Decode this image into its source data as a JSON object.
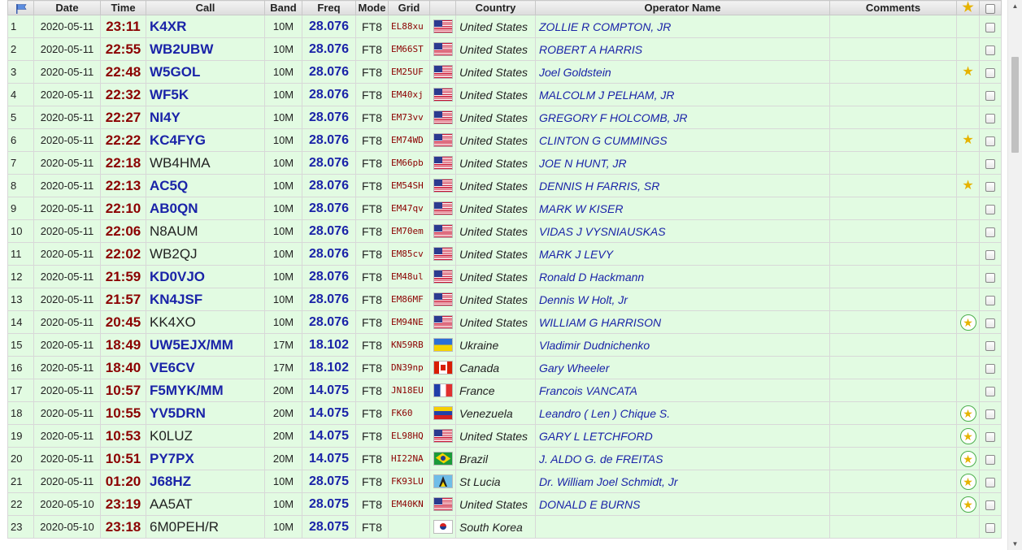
{
  "header": {
    "date": "Date",
    "time": "Time",
    "call": "Call",
    "band": "Band",
    "freq": "Freq",
    "mode": "Mode",
    "grid": "Grid",
    "country": "Country",
    "operator": "Operator Name",
    "comments": "Comments",
    "header_flag_icon": "blue-flag-icon",
    "header_star_icon": "star-icon"
  },
  "colors": {
    "row_bg": "#e2fbe2",
    "time_color": "#8b0000",
    "call_color": "#1a23a8",
    "star_color": "#e6b300",
    "star_ring_color": "#4cae4c"
  },
  "rows": [
    {
      "num": "1",
      "date": "2020-05-11",
      "time": "23:11",
      "call": "K4XR",
      "call_bold": true,
      "band": "10M",
      "freq": "28.076",
      "mode": "FT8",
      "grid": "EL88xu",
      "flag": "us",
      "country": "United States",
      "operator": "ZOLLIE R COMPTON, JR",
      "star": ""
    },
    {
      "num": "2",
      "date": "2020-05-11",
      "time": "22:55",
      "call": "WB2UBW",
      "call_bold": true,
      "band": "10M",
      "freq": "28.076",
      "mode": "FT8",
      "grid": "EM66ST",
      "flag": "us",
      "country": "United States",
      "operator": "ROBERT A HARRIS",
      "star": ""
    },
    {
      "num": "3",
      "date": "2020-05-11",
      "time": "22:48",
      "call": "W5GOL",
      "call_bold": true,
      "band": "10M",
      "freq": "28.076",
      "mode": "FT8",
      "grid": "EM25UF",
      "flag": "us",
      "country": "United States",
      "operator": "Joel Goldstein",
      "star": "plain"
    },
    {
      "num": "4",
      "date": "2020-05-11",
      "time": "22:32",
      "call": "WF5K",
      "call_bold": true,
      "band": "10M",
      "freq": "28.076",
      "mode": "FT8",
      "grid": "EM40xj",
      "flag": "us",
      "country": "United States",
      "operator": "MALCOLM J PELHAM, JR",
      "star": ""
    },
    {
      "num": "5",
      "date": "2020-05-11",
      "time": "22:27",
      "call": "NI4Y",
      "call_bold": true,
      "band": "10M",
      "freq": "28.076",
      "mode": "FT8",
      "grid": "EM73vv",
      "flag": "us",
      "country": "United States",
      "operator": "GREGORY F HOLCOMB, JR",
      "star": ""
    },
    {
      "num": "6",
      "date": "2020-05-11",
      "time": "22:22",
      "call": "KC4FYG",
      "call_bold": true,
      "band": "10M",
      "freq": "28.076",
      "mode": "FT8",
      "grid": "EM74WD",
      "flag": "us",
      "country": "United States",
      "operator": "CLINTON G CUMMINGS",
      "star": "plain"
    },
    {
      "num": "7",
      "date": "2020-05-11",
      "time": "22:18",
      "call": "WB4HMA",
      "call_bold": false,
      "band": "10M",
      "freq": "28.076",
      "mode": "FT8",
      "grid": "EM66pb",
      "flag": "us",
      "country": "United States",
      "operator": "JOE N HUNT, JR",
      "star": ""
    },
    {
      "num": "8",
      "date": "2020-05-11",
      "time": "22:13",
      "call": "AC5Q",
      "call_bold": true,
      "band": "10M",
      "freq": "28.076",
      "mode": "FT8",
      "grid": "EM54SH",
      "flag": "us",
      "country": "United States",
      "operator": "DENNIS H FARRIS, SR",
      "star": "plain"
    },
    {
      "num": "9",
      "date": "2020-05-11",
      "time": "22:10",
      "call": "AB0QN",
      "call_bold": true,
      "band": "10M",
      "freq": "28.076",
      "mode": "FT8",
      "grid": "EM47qv",
      "flag": "us",
      "country": "United States",
      "operator": "MARK W KISER",
      "star": ""
    },
    {
      "num": "10",
      "date": "2020-05-11",
      "time": "22:06",
      "call": "N8AUM",
      "call_bold": false,
      "band": "10M",
      "freq": "28.076",
      "mode": "FT8",
      "grid": "EM70em",
      "flag": "us",
      "country": "United States",
      "operator": "VIDAS J VYSNIAUSKAS",
      "star": ""
    },
    {
      "num": "11",
      "date": "2020-05-11",
      "time": "22:02",
      "call": "WB2QJ",
      "call_bold": false,
      "band": "10M",
      "freq": "28.076",
      "mode": "FT8",
      "grid": "EM85cv",
      "flag": "us",
      "country": "United States",
      "operator": "MARK J LEVY",
      "star": ""
    },
    {
      "num": "12",
      "date": "2020-05-11",
      "time": "21:59",
      "call": "KD0VJO",
      "call_bold": true,
      "band": "10M",
      "freq": "28.076",
      "mode": "FT8",
      "grid": "EM48ul",
      "flag": "us",
      "country": "United States",
      "operator": "Ronald D Hackmann",
      "star": ""
    },
    {
      "num": "13",
      "date": "2020-05-11",
      "time": "21:57",
      "call": "KN4JSF",
      "call_bold": true,
      "band": "10M",
      "freq": "28.076",
      "mode": "FT8",
      "grid": "EM86MF",
      "flag": "us",
      "country": "United States",
      "operator": "Dennis W Holt, Jr",
      "star": ""
    },
    {
      "num": "14",
      "date": "2020-05-11",
      "time": "20:45",
      "call": "KK4XO",
      "call_bold": false,
      "band": "10M",
      "freq": "28.076",
      "mode": "FT8",
      "grid": "EM94NE",
      "flag": "us",
      "country": "United States",
      "operator": "WILLIAM G HARRISON",
      "star": "ring"
    },
    {
      "num": "15",
      "date": "2020-05-11",
      "time": "18:49",
      "call": "UW5EJX/MM",
      "call_bold": true,
      "band": "17M",
      "freq": "18.102",
      "mode": "FT8",
      "grid": "KN59RB",
      "flag": "ua",
      "country": "Ukraine",
      "operator": "Vladimir Dudnichenko",
      "star": ""
    },
    {
      "num": "16",
      "date": "2020-05-11",
      "time": "18:40",
      "call": "VE6CV",
      "call_bold": true,
      "band": "17M",
      "freq": "18.102",
      "mode": "FT8",
      "grid": "DN39np",
      "flag": "ca",
      "country": "Canada",
      "operator": "Gary Wheeler",
      "star": ""
    },
    {
      "num": "17",
      "date": "2020-05-11",
      "time": "10:57",
      "call": "F5MYK/MM",
      "call_bold": true,
      "band": "20M",
      "freq": "14.075",
      "mode": "FT8",
      "grid": "JN18EU",
      "flag": "fr",
      "country": "France",
      "operator": "Francois VANCATA",
      "star": ""
    },
    {
      "num": "18",
      "date": "2020-05-11",
      "time": "10:55",
      "call": "YV5DRN",
      "call_bold": true,
      "band": "20M",
      "freq": "14.075",
      "mode": "FT8",
      "grid": "FK60",
      "flag": "ve",
      "country": "Venezuela",
      "operator": "Leandro ( Len ) Chique S.",
      "star": "ring"
    },
    {
      "num": "19",
      "date": "2020-05-11",
      "time": "10:53",
      "call": "K0LUZ",
      "call_bold": false,
      "band": "20M",
      "freq": "14.075",
      "mode": "FT8",
      "grid": "EL98HQ",
      "flag": "us",
      "country": "United States",
      "operator": "GARY L LETCHFORD",
      "star": "ring"
    },
    {
      "num": "20",
      "date": "2020-05-11",
      "time": "10:51",
      "call": "PY7PX",
      "call_bold": true,
      "band": "20M",
      "freq": "14.075",
      "mode": "FT8",
      "grid": "HI22NA",
      "flag": "br",
      "country": "Brazil",
      "operator": "J. ALDO G. de FREITAS",
      "star": "ring"
    },
    {
      "num": "21",
      "date": "2020-05-11",
      "time": "01:20",
      "call": "J68HZ",
      "call_bold": true,
      "band": "10M",
      "freq": "28.075",
      "mode": "FT8",
      "grid": "FK93LU",
      "flag": "lc",
      "country": "St Lucia",
      "operator": "Dr. William Joel Schmidt, Jr",
      "star": "ring"
    },
    {
      "num": "22",
      "date": "2020-05-10",
      "time": "23:19",
      "call": "AA5AT",
      "call_bold": false,
      "band": "10M",
      "freq": "28.075",
      "mode": "FT8",
      "grid": "EM40KN",
      "flag": "us",
      "country": "United States",
      "operator": "DONALD E BURNS",
      "star": "ring"
    },
    {
      "num": "23",
      "date": "2020-05-10",
      "time": "23:18",
      "call": "6M0PEH/R",
      "call_bold": false,
      "band": "10M",
      "freq": "28.075",
      "mode": "FT8",
      "grid": "",
      "flag": "kr",
      "country": "South Korea",
      "operator": "",
      "star": ""
    }
  ]
}
